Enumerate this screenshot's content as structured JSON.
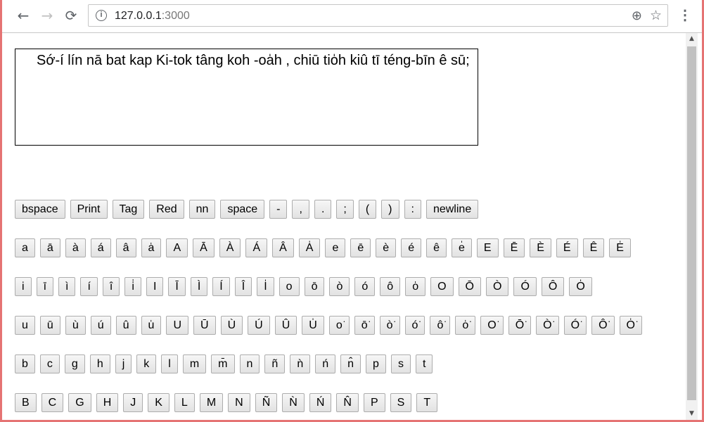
{
  "browser": {
    "url_host": "127.0.0.1",
    "url_port": ":3000",
    "icons": {
      "back": "back-arrow-icon",
      "forward": "forward-arrow-icon",
      "reload": "reload-icon",
      "info": "info-icon",
      "zoom": "zoom-icon",
      "star": "bookmark-star-icon",
      "menu": "kebab-menu-icon"
    }
  },
  "editor": {
    "text": "Sớ-í lín nā bat kap Ki-tok tâng koh -oa̍h , chiū tio̍h kiû tī téng-bīn ê sū;"
  },
  "controls": [
    "bspace",
    "Print",
    "Tag",
    "Red",
    "nn",
    "space",
    "-",
    ",",
    ".",
    ";",
    "(",
    ")",
    ":",
    "newline"
  ],
  "rows": [
    [
      "a",
      "ā",
      "à",
      "á",
      "â",
      "a̍",
      "A",
      "Ā",
      "À",
      "Á",
      "Â",
      "A̍",
      "e",
      "ē",
      "è",
      "é",
      "ê",
      "e̍",
      "E",
      "Ē",
      "È",
      "É",
      "Ê",
      "E̍"
    ],
    [
      "i",
      "ī",
      "ì",
      "í",
      "î",
      "i̍",
      "I",
      "Ī",
      "Ì",
      "Í",
      "Î",
      "I̍",
      "o",
      "ō",
      "ò",
      "ó",
      "ô",
      "o̍",
      "O",
      "Ō",
      "Ò",
      "Ó",
      "Ô",
      "O̍"
    ],
    [
      "u",
      "ū",
      "ù",
      "ú",
      "û",
      "u̍",
      "U",
      "Ū",
      "Ù",
      "Ú",
      "Û",
      "U̍",
      "o͘",
      "ō͘",
      "ò͘",
      "ó͘",
      "ô͘",
      "o̍͘",
      "O͘",
      "Ō͘",
      "Ò͘",
      "Ó͘",
      "Ô͘",
      "O̍͘"
    ],
    [
      "b",
      "c",
      "g",
      "h",
      "j",
      "k",
      "l",
      "m",
      "m̄",
      "n",
      "ñ",
      "ǹ",
      "ń",
      "n̂",
      "p",
      "s",
      "t"
    ],
    [
      "B",
      "C",
      "G",
      "H",
      "J",
      "K",
      "L",
      "M",
      "N",
      "Ñ",
      "Ǹ",
      "Ń",
      "N̂",
      "P",
      "S",
      "T"
    ]
  ]
}
